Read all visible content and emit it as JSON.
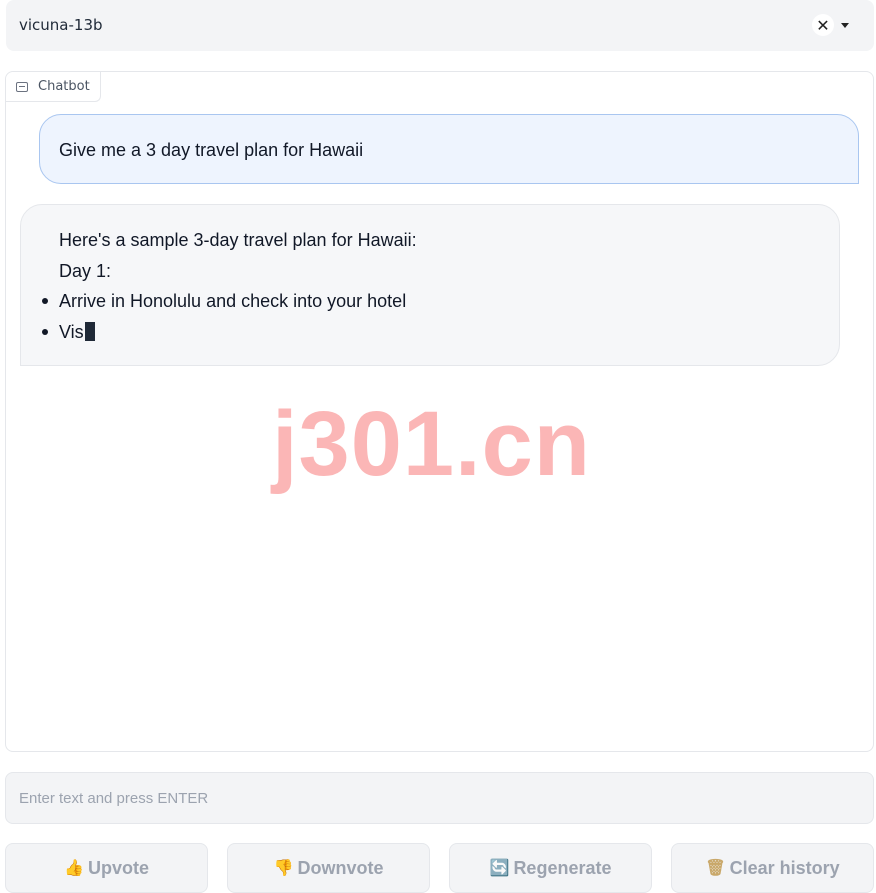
{
  "model_selector": {
    "value": "vicuna-13b",
    "clear_symbol": "✕"
  },
  "chatbot": {
    "label": "Chatbot",
    "messages": [
      {
        "role": "user",
        "text": "Give me a 3 day travel plan for Hawaii"
      },
      {
        "role": "bot",
        "intro": "Here's a sample 3-day travel plan for Hawaii:",
        "heading": "Day 1:",
        "bullets": [
          "Arrive in Honolulu and check into your hotel",
          "Vis"
        ]
      }
    ]
  },
  "watermark": "j301.cn",
  "input": {
    "placeholder": "Enter text and press ENTER",
    "value": ""
  },
  "buttons": {
    "upvote": {
      "icon": "👍",
      "label": "Upvote"
    },
    "downvote": {
      "icon": "👎",
      "label": "Downvote"
    },
    "regenerate": {
      "icon": "🔄",
      "label": "Regenerate"
    },
    "clear": {
      "icon": "🗑",
      "label": "Clear history"
    }
  }
}
